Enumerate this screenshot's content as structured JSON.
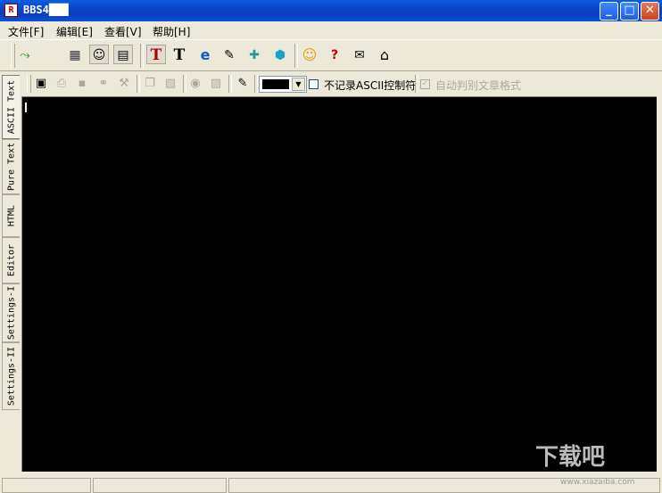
{
  "window": {
    "title": "BBS4███",
    "icon": "R"
  },
  "window_controls": {
    "minimize": "_",
    "maximize": "□",
    "close": "✕"
  },
  "menu": [
    "文件[F]",
    "编辑[E]",
    "查看[V]",
    "帮助[H]"
  ],
  "toolbar_icons": {
    "exit": "⤳",
    "window": "▦",
    "faces": "☺",
    "comment": "▤",
    "text_red": "T",
    "text_plain": "T",
    "ie": "e",
    "edit": "✎",
    "puzzle": "✚",
    "box": "⬢",
    "smiley": "☺",
    "help": "?",
    "mail": "✉",
    "home": "⌂"
  },
  "toolbar2_icons": {
    "book": "▣",
    "print": "⎙",
    "save": "▪",
    "link": "⚭",
    "wrench": "⚒",
    "copy": "❐",
    "paste": "▧",
    "find": "◉",
    "replace": "▨",
    "note": "✎"
  },
  "color_picker": {
    "value": "#000000",
    "arrow": "▼"
  },
  "options": {
    "no_ascii_control": {
      "label": "不记录ASCII控制符",
      "checked": false
    },
    "auto_detect_format": {
      "label": "自动判别文章格式",
      "checked": true,
      "check_mark": "✓"
    }
  },
  "side_tabs": [
    "ASCII Text",
    "Pure Text",
    "HTML",
    "Editor",
    "Settings-I",
    "Settings-II"
  ],
  "active_side_tab": "ASCII Text",
  "editor": {
    "background": "#000000",
    "caret_color": "#ffffff"
  },
  "watermark": {
    "text": "下载吧",
    "url": "www.xiazaiba.com"
  }
}
